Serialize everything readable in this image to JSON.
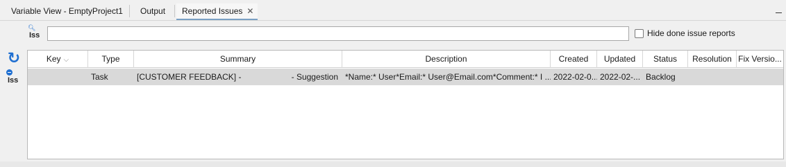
{
  "tabs": [
    {
      "label": "Variable View - EmptyProject1"
    },
    {
      "label": "Output"
    },
    {
      "label": "Reported Issues",
      "close": "✕"
    }
  ],
  "toolbar": {
    "search_icon_label": "Iss",
    "refresh_icon": "refresh-icon",
    "remove_icon_label": "Iss"
  },
  "search": {
    "value": "",
    "placeholder": ""
  },
  "filter": {
    "hide_done_label": "Hide done issue reports",
    "checked": false
  },
  "table": {
    "columns": [
      "Key",
      "Type",
      "Summary",
      "Description",
      "Created",
      "Updated",
      "Status",
      "Resolution",
      "Fix Versio..."
    ],
    "rows": [
      {
        "key": "",
        "type": "Task",
        "summary_left": "[CUSTOMER FEEDBACK] -",
        "summary_right": "- Suggestion",
        "description": "*Name:* User*Email:* User@Email.com*Comment:* I ...",
        "created": "2022-02-0...",
        "updated": "2022-02-...",
        "status": "Backlog",
        "resolution": "",
        "fix_version": ""
      }
    ]
  }
}
